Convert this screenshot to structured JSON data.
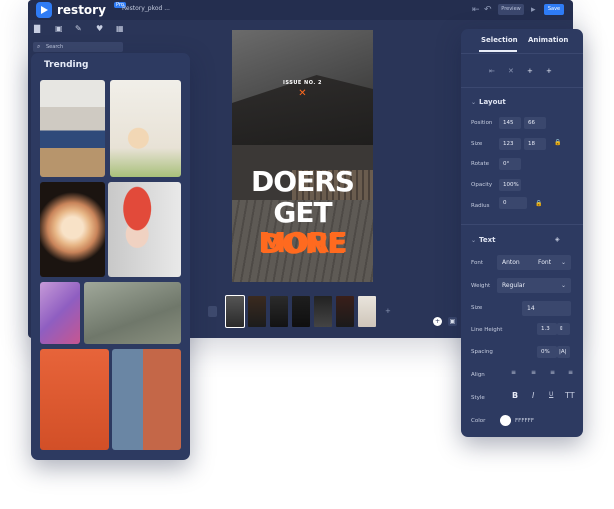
{
  "app": {
    "brand": "restory",
    "brand_badge": "Pro",
    "file_name": "Restory_pkod ...",
    "preview_label": "Preview",
    "save_label": "Save"
  },
  "search": {
    "placeholder": "Search"
  },
  "canvas": {
    "issue": "ISSUE NO. 2",
    "line1": "DOERS",
    "line2a": "GET ",
    "line2b": "MORE",
    "line3": "DONE",
    "accent_color": "#ff6a1f"
  },
  "trending": {
    "title": "Trending"
  },
  "props": {
    "tab_selection": "Selection",
    "tab_animation": "Animation",
    "layout": {
      "title": "Layout",
      "position_label": "Position",
      "position_x": "145",
      "position_y": "66",
      "size_label": "Size",
      "size_w": "123",
      "size_h": "18",
      "rotate_label": "Rotate",
      "rotate": "0°",
      "opacity_label": "Opacity",
      "opacity": "100%",
      "radius_label": "Radius",
      "radius": "0"
    },
    "text": {
      "title": "Text",
      "font_label": "Font",
      "font_value": "Anton",
      "font_button": "Font",
      "weight_label": "Weight",
      "weight_value": "Regular",
      "size_label": "Size",
      "size_value": "14",
      "line_height_label": "Line Height",
      "line_height_value": "1.3",
      "spacing_label": "Spacing",
      "spacing_value": "0%",
      "align_label": "Align",
      "style_label": "Style",
      "color_label": "Color",
      "color_value": "FFFFFF"
    }
  }
}
